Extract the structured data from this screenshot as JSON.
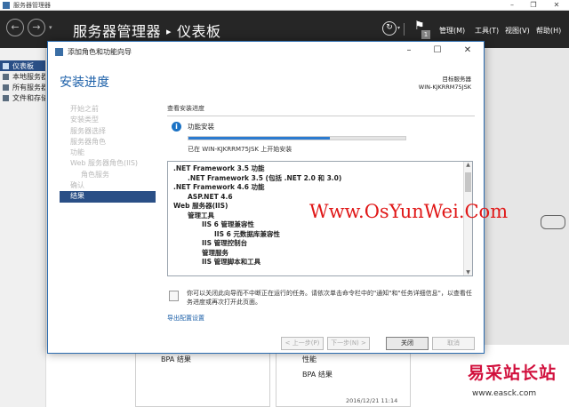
{
  "window": {
    "title": "服务器管理器"
  },
  "topbar": {
    "breadcrumb_root": "服务器管理器",
    "breadcrumb_sep": "▸",
    "breadcrumb_current": "仪表板",
    "notification_count": "1",
    "menus": [
      "管理(M)",
      "工具(T)",
      "视图(V)",
      "帮助(H)"
    ]
  },
  "sidebar": {
    "items": [
      {
        "label": "仪表板"
      },
      {
        "label": "本地服务器"
      },
      {
        "label": "所有服务器"
      },
      {
        "label": "文件和存储服务"
      }
    ]
  },
  "background": {
    "bpa_left": "BPA 结果",
    "perf": "性能",
    "bpa_right": "BPA 结果",
    "timestamp": "2016/12/21 11:14"
  },
  "dialog": {
    "title": "添加角色和功能向导",
    "heading": "安装进度",
    "target_label": "目标服务器",
    "target_server": "WIN-KJKRRM75JSK",
    "steps": [
      {
        "label": "开始之前",
        "sub": false,
        "current": false
      },
      {
        "label": "安装类型",
        "sub": false,
        "current": false
      },
      {
        "label": "服务器选择",
        "sub": false,
        "current": false
      },
      {
        "label": "服务器角色",
        "sub": false,
        "current": false
      },
      {
        "label": "功能",
        "sub": false,
        "current": false
      },
      {
        "label": "Web 服务器角色(IIS)",
        "sub": false,
        "current": false
      },
      {
        "label": "角色服务",
        "sub": true,
        "current": false
      },
      {
        "label": "确认",
        "sub": false,
        "current": false
      },
      {
        "label": "结果",
        "sub": false,
        "current": true
      }
    ],
    "section_label": "查看安装进度",
    "feature_install": "功能安装",
    "progress": 0.65,
    "started_text": "已在 WIN-KJKRRM75JSK 上开始安装",
    "list_items": [
      {
        "text": ".NET Framework 3.5 功能",
        "indent": 0
      },
      {
        "text": ".NET Framework 3.5 (包括 .NET 2.0 和 3.0)",
        "indent": 1
      },
      {
        "text": ".NET Framework 4.6 功能",
        "indent": 0
      },
      {
        "text": "ASP.NET 4.6",
        "indent": 1
      },
      {
        "text": "Web 服务器(IIS)",
        "indent": 0
      },
      {
        "text": "管理工具",
        "indent": 1
      },
      {
        "text": "IIS 6 管理兼容性",
        "indent": 2
      },
      {
        "text": "IIS 6 元数据库兼容性",
        "indent": 3
      },
      {
        "text": "IIS 管理控制台",
        "indent": 2
      },
      {
        "text": "管理服务",
        "indent": 2
      },
      {
        "text": "IIS 管理脚本和工具",
        "indent": 2
      }
    ],
    "note": "你可以关闭此向导而不中断正在运行的任务。请依次单击命令栏中的\"通知\"和\"任务详细信息\"，以查看任务进度或再次打开此页面。",
    "export_link": "导出配置设置",
    "buttons": {
      "prev": "< 上一步(P)",
      "next": "下一步(N) >",
      "close": "关闭",
      "cancel": "取消"
    }
  },
  "watermark": {
    "text": "Www.OsYunWei.Com"
  },
  "site_logo": {
    "title": "易采站长站",
    "url": "www.easck.com"
  }
}
